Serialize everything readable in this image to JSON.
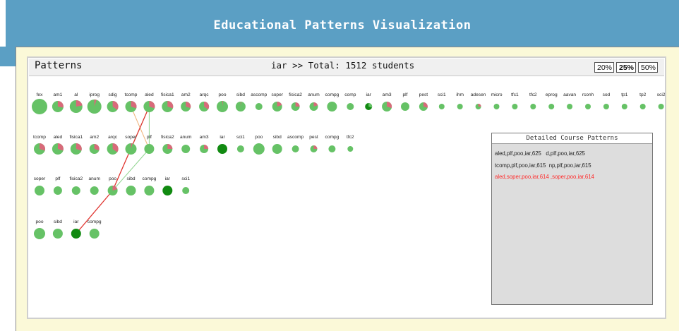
{
  "app": {
    "title": "Educational Patterns Visualization"
  },
  "panel": {
    "title": "Patterns",
    "summary": "iar >> Total: 1512 students",
    "zoom_options": [
      "20%",
      "25%",
      "50%"
    ],
    "zoom_selected": "25%"
  },
  "colors": {
    "pass": "#66c266",
    "fail": "#d86a7a",
    "selected": "#118a11",
    "edge_red": "#e0342f",
    "edge_green": "#8fd48f",
    "edge_orange": "#f0b37a"
  },
  "rows": [
    {
      "courses": [
        {
          "label": "fex",
          "size": 11,
          "fail": 0.0
        },
        {
          "label": "am1",
          "size": 8,
          "fail": 0.28
        },
        {
          "label": "al",
          "size": 9,
          "fail": 0.22
        },
        {
          "label": "iprog",
          "size": 10,
          "fail": 0.05
        },
        {
          "label": "sdig",
          "size": 8,
          "fail": 0.35
        },
        {
          "label": "tcomp",
          "size": 8,
          "fail": 0.3
        },
        {
          "label": "aled",
          "size": 8,
          "fail": 0.3
        },
        {
          "label": "fisica1",
          "size": 8,
          "fail": 0.3
        },
        {
          "label": "am2",
          "size": 7,
          "fail": 0.3
        },
        {
          "label": "arqc",
          "size": 7,
          "fail": 0.35
        },
        {
          "label": "poo",
          "size": 8,
          "fail": 0.02
        },
        {
          "label": "sibd",
          "size": 7,
          "fail": 0.02
        },
        {
          "label": "ascomp",
          "size": 5,
          "fail": 0.0
        },
        {
          "label": "soper",
          "size": 7,
          "fail": 0.2
        },
        {
          "label": "fisica2",
          "size": 6,
          "fail": 0.25
        },
        {
          "label": "anum",
          "size": 6,
          "fail": 0.2
        },
        {
          "label": "compg",
          "size": 7,
          "fail": 0.0
        },
        {
          "label": "comp",
          "size": 5,
          "fail": 0.0
        },
        {
          "label": "iar",
          "size": 5,
          "fail": 0.3,
          "selected": true
        },
        {
          "label": "am3",
          "size": 7,
          "fail": 0.3
        },
        {
          "label": "plf",
          "size": 6,
          "fail": 0.0
        },
        {
          "label": "pest",
          "size": 6,
          "fail": 0.3
        },
        {
          "label": "sci1",
          "size": 4,
          "fail": 0.0
        },
        {
          "label": "ihm",
          "size": 4,
          "fail": 0.0
        },
        {
          "label": "adesen",
          "size": 4,
          "fail": 0.25
        },
        {
          "label": "micro",
          "size": 4,
          "fail": 0.0
        },
        {
          "label": "tfc1",
          "size": 4,
          "fail": 0.0
        },
        {
          "label": "tfc2",
          "size": 4,
          "fail": 0.0
        },
        {
          "label": "eprog",
          "size": 4,
          "fail": 0.0
        },
        {
          "label": "aavan",
          "size": 4,
          "fail": 0.0
        },
        {
          "label": "rconh",
          "size": 4,
          "fail": 0.0
        },
        {
          "label": "sod",
          "size": 4,
          "fail": 0.0
        },
        {
          "label": "tp1",
          "size": 4,
          "fail": 0.0
        },
        {
          "label": "tp2",
          "size": 4,
          "fail": 0.0
        },
        {
          "label": "sci2",
          "size": 4,
          "fail": 0.0
        }
      ]
    },
    {
      "courses": [
        {
          "label": "tcomp",
          "size": 8,
          "fail": 0.3
        },
        {
          "label": "aled",
          "size": 8,
          "fail": 0.3
        },
        {
          "label": "fisica1",
          "size": 8,
          "fail": 0.3
        },
        {
          "label": "am2",
          "size": 7,
          "fail": 0.3
        },
        {
          "label": "arqc",
          "size": 8,
          "fail": 0.35
        },
        {
          "label": "soper",
          "size": 8,
          "fail": 0.05
        },
        {
          "label": "plf",
          "size": 7,
          "fail": 0.0
        },
        {
          "label": "fisica2",
          "size": 7,
          "fail": 0.25
        },
        {
          "label": "anum",
          "size": 6,
          "fail": 0.0
        },
        {
          "label": "am3",
          "size": 6,
          "fail": 0.25
        },
        {
          "label": "iar",
          "size": 7,
          "fail": 0.0,
          "selected": true
        },
        {
          "label": "sci1",
          "size": 5,
          "fail": 0.0
        },
        {
          "label": "poo",
          "size": 8,
          "fail": 0.0
        },
        {
          "label": "sibd",
          "size": 7,
          "fail": 0.0
        },
        {
          "label": "ascomp",
          "size": 5,
          "fail": 0.0
        },
        {
          "label": "pest",
          "size": 5,
          "fail": 0.25
        },
        {
          "label": "compg",
          "size": 5,
          "fail": 0.0
        },
        {
          "label": "tfc2",
          "size": 4,
          "fail": 0.0
        }
      ]
    },
    {
      "courses": [
        {
          "label": "soper",
          "size": 7,
          "fail": 0.0
        },
        {
          "label": "plf",
          "size": 6,
          "fail": 0.0
        },
        {
          "label": "fisica2",
          "size": 6,
          "fail": 0.0
        },
        {
          "label": "anum",
          "size": 6,
          "fail": 0.0
        },
        {
          "label": "poo",
          "size": 7,
          "fail": 0.2
        },
        {
          "label": "sibd",
          "size": 7,
          "fail": 0.0
        },
        {
          "label": "compg",
          "size": 7,
          "fail": 0.0
        },
        {
          "label": "iar",
          "size": 7,
          "fail": 0.0,
          "selected": true
        },
        {
          "label": "sci1",
          "size": 5,
          "fail": 0.0
        }
      ]
    },
    {
      "courses": [
        {
          "label": "poo",
          "size": 8,
          "fail": 0.0
        },
        {
          "label": "sibd",
          "size": 7,
          "fail": 0.0
        },
        {
          "label": "iar",
          "size": 7,
          "fail": 0.0,
          "selected": true
        },
        {
          "label": "compg",
          "size": 7,
          "fail": 0.0
        }
      ]
    }
  ],
  "edges": [
    {
      "from": [
        0,
        6
      ],
      "to": [
        1,
        6
      ],
      "color": "edge_green"
    },
    {
      "from": [
        0,
        6
      ],
      "to": [
        1,
        5
      ],
      "color": "edge_green"
    },
    {
      "from": [
        0,
        5
      ],
      "to": [
        1,
        6
      ],
      "color": "edge_orange"
    },
    {
      "from": [
        0,
        6
      ],
      "to": [
        2,
        4
      ],
      "color": "edge_red"
    },
    {
      "from": [
        1,
        6
      ],
      "to": [
        2,
        4
      ],
      "color": "edge_green"
    },
    {
      "from": [
        2,
        4
      ],
      "to": [
        3,
        2
      ],
      "color": "edge_red"
    }
  ],
  "detail": {
    "title": "Detailed Course Patterns",
    "lines": [
      {
        "text": "aled,plf,poo,iar,625   d,plf,poo,iar,625",
        "highlight": false
      },
      {
        "text": "tcomp,plf,poo,iar,615  np,plf,poo,iar,615",
        "highlight": false
      },
      {
        "text": "aled,soper,poo,iar,614 ,soper,poo,iar,614",
        "highlight": true
      }
    ]
  }
}
